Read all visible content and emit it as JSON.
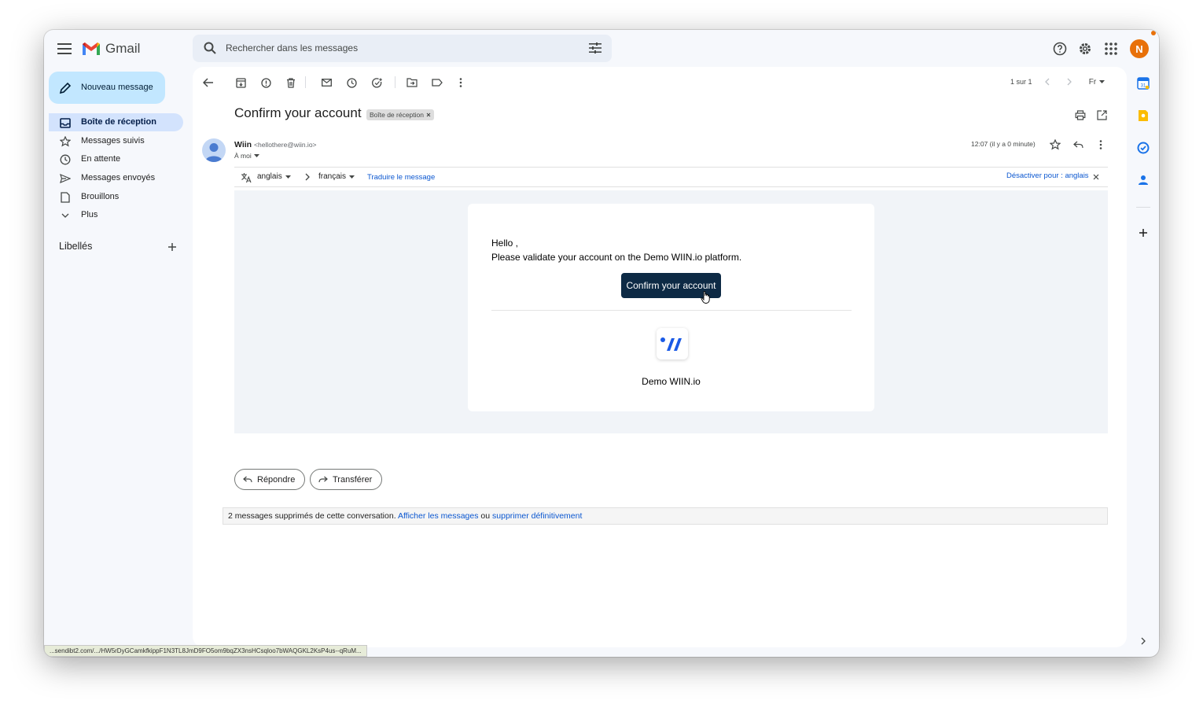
{
  "app": {
    "name": "Gmail",
    "search_placeholder": "Rechercher dans les messages",
    "avatar_initial": "N",
    "accent_color": "#0b57d0",
    "avatar_color": "#e8710a"
  },
  "sidebar": {
    "compose_label": "Nouveau message",
    "items": [
      {
        "label": "Boîte de réception",
        "icon": "inbox-icon",
        "active": true
      },
      {
        "label": "Messages suivis",
        "icon": "star-icon"
      },
      {
        "label": "En attente",
        "icon": "clock-icon"
      },
      {
        "label": "Messages envoyés",
        "icon": "send-icon"
      },
      {
        "label": "Brouillons",
        "icon": "draft-icon"
      },
      {
        "label": "Plus",
        "icon": "chevron-down-icon"
      }
    ],
    "labels_title": "Libellés"
  },
  "toolbar": {
    "pager": "1 sur 1",
    "language_selector": "Fr"
  },
  "message": {
    "subject": "Confirm your account",
    "label_badge": "Boîte de réception",
    "sender_name": "Wiin",
    "sender_email": "<hellothere@wiin.io>",
    "to": "À moi",
    "timestamp": "12:07 (il y a 0 minute)"
  },
  "translate": {
    "from_lang": "anglais",
    "to_lang": "français",
    "translate_link": "Traduire le message",
    "disable_link": "Désactiver pour : anglais"
  },
  "email_body": {
    "greeting": "Hello ,",
    "text": "Please validate your account on the Demo WIIN.io platform.",
    "button_label": "Confirm your account",
    "brand_name": "Demo WIIN.io",
    "button_color": "#0d2a45"
  },
  "actions": {
    "reply": "Répondre",
    "forward": "Transférer"
  },
  "deleted_notice": {
    "text": "2 messages supprimés de cette conversation.",
    "show_link": "Afficher les messages",
    "or": "ou",
    "delete_link": "supprimer définitivement"
  },
  "status_url": "...sendibt2.com/.../HW5rDyGCamkfkippF1N3TL8JmD9FO5om9bqZX3nsHCsqloo7bWAQGKL2KsP4us--qRuM..."
}
